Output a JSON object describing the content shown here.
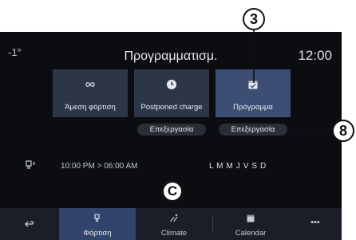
{
  "header": {
    "status_left": "-1°",
    "title": "Προγραμματισμ.",
    "clock": "12:00"
  },
  "modes": [
    {
      "label": "Άμεση φόρτιση",
      "icon": "infinity-icon"
    },
    {
      "label": "Postponed charge",
      "icon": "clock-icon"
    },
    {
      "label": "Πρόγραμμα",
      "icon": "calendar-check-icon",
      "selected": true
    }
  ],
  "edit_buttons": [
    {
      "label": "Επεξεργασία"
    },
    {
      "label": "Επεξεργασία"
    }
  ],
  "schedule": {
    "icon": "charging-plug-icon",
    "time_range": "10:00 PM > 06:00 AM",
    "days": "L M M J V S D"
  },
  "nav": [
    {
      "label": "",
      "icon": "back-arrow-icon"
    },
    {
      "label": "Φόρτιση",
      "icon": "charging-plug-icon",
      "active": true
    },
    {
      "label": "Climate",
      "icon": "climate-icon"
    },
    {
      "label": "Calendar",
      "icon": "calendar-icon"
    },
    {
      "label": "•••",
      "icon": "more-icon"
    }
  ],
  "callouts": {
    "c3": "3",
    "c8": "8",
    "cC": "C"
  },
  "colors": {
    "screen_bg": "#0b0d11",
    "card_bg": "#2d3649",
    "card_selected": "#3c4e74",
    "nav_active": "#30446c"
  }
}
